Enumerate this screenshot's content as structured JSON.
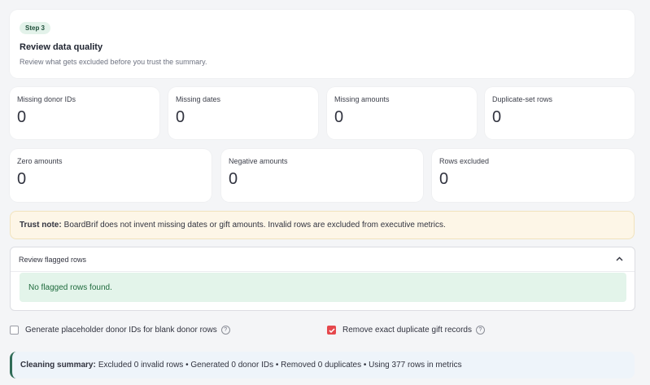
{
  "step": {
    "badge": "Step 3",
    "title": "Review data quality",
    "subtitle": "Review what gets excluded before you trust the summary."
  },
  "metrics_row1": [
    {
      "label": "Missing donor IDs",
      "value": "0"
    },
    {
      "label": "Missing dates",
      "value": "0"
    },
    {
      "label": "Missing amounts",
      "value": "0"
    },
    {
      "label": "Duplicate-set rows",
      "value": "0"
    }
  ],
  "metrics_row2": [
    {
      "label": "Zero amounts",
      "value": "0"
    },
    {
      "label": "Negative amounts",
      "value": "0"
    },
    {
      "label": "Rows excluded",
      "value": "0"
    }
  ],
  "trust_note": {
    "label": "Trust note:",
    "text": "BoardBrif does not invent missing dates or gift amounts. Invalid rows are excluded from executive metrics."
  },
  "flagged": {
    "header": "Review flagged rows",
    "message": "No flagged rows found."
  },
  "options": {
    "placeholder_ids": {
      "label": "Generate placeholder donor IDs for blank donor rows",
      "checked": false
    },
    "remove_duplicates": {
      "label": "Remove exact duplicate gift records",
      "checked": true
    }
  },
  "summary": {
    "label": "Cleaning summary:",
    "text": "Excluded 0 invalid rows • Generated 0 donor IDs • Removed 0 duplicates • Using 377 rows in metrics"
  },
  "colors": {
    "accent": "#e5484d",
    "success_bg": "#e3f4ea",
    "warning_bg": "#fdf6e7",
    "info_bg": "#eef4fa"
  }
}
